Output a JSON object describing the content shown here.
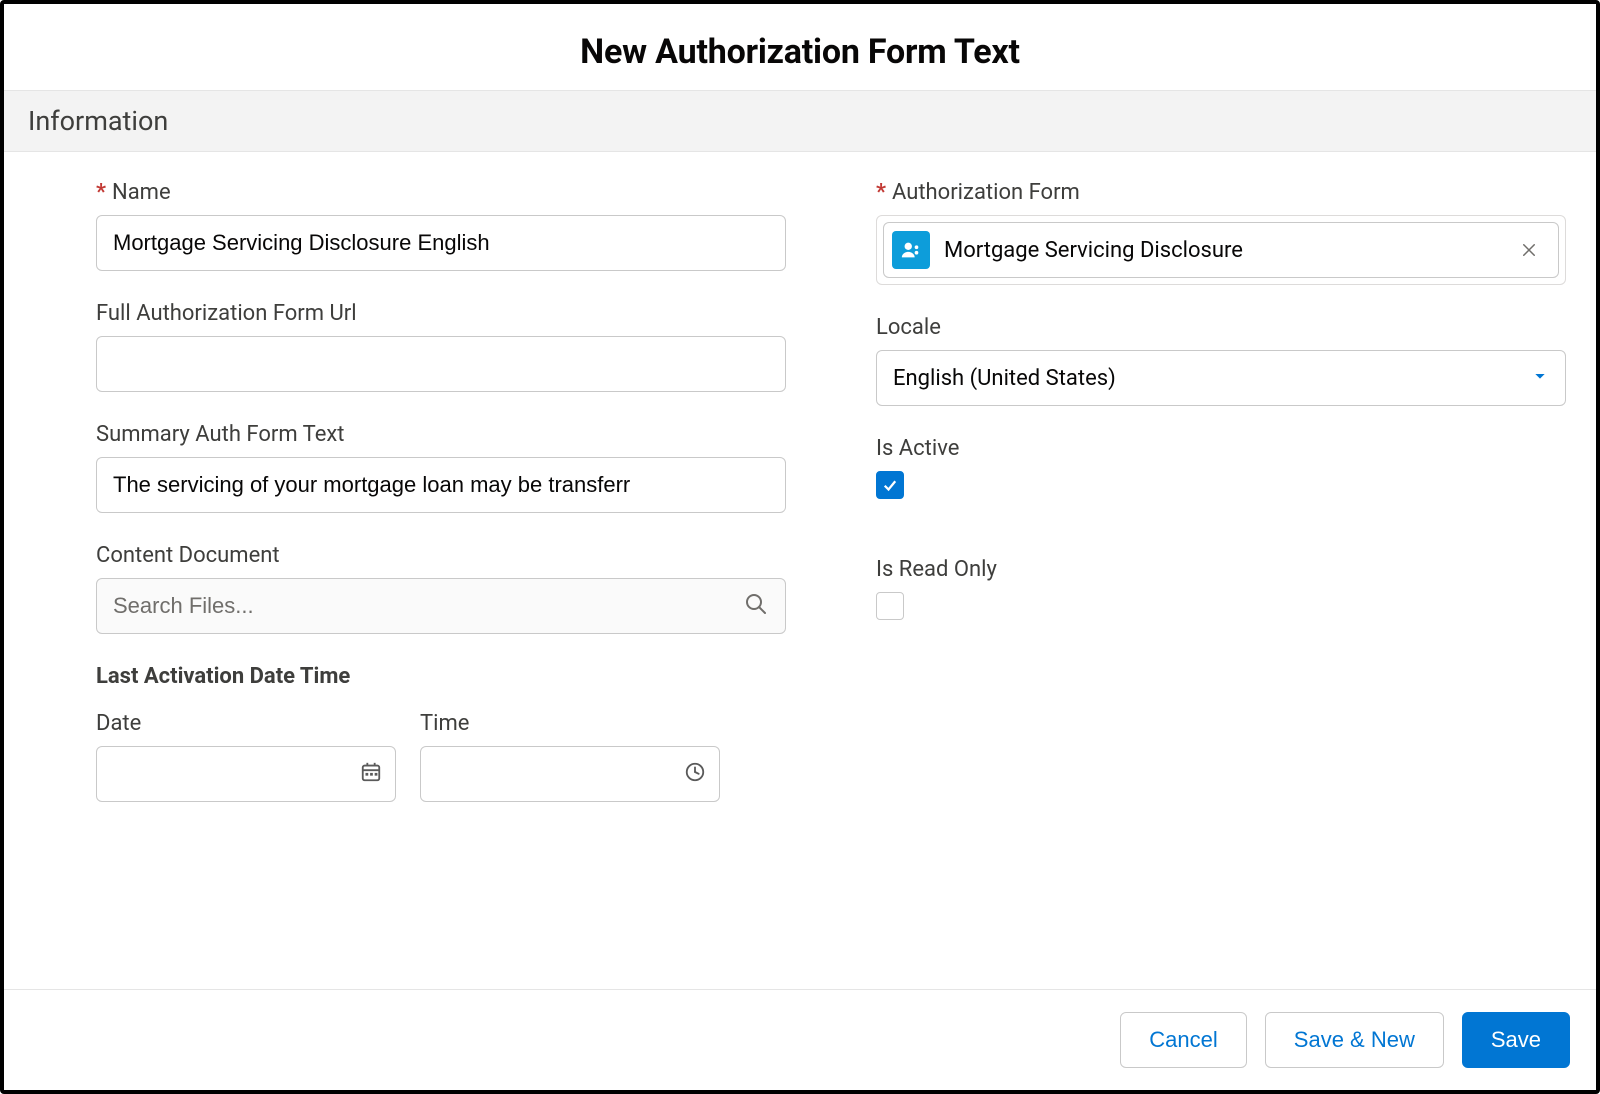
{
  "header": {
    "title": "New Authorization Form Text"
  },
  "section": {
    "title": "Information"
  },
  "fields": {
    "name": {
      "label": "Name",
      "value": "Mortgage Servicing Disclosure English",
      "required_marker": "*"
    },
    "auth_form": {
      "label": "Authorization Form",
      "value": "Mortgage Servicing Disclosure",
      "required_marker": "*"
    },
    "full_url": {
      "label": "Full Authorization Form Url",
      "value": ""
    },
    "locale": {
      "label": "Locale",
      "value": "English (United States)"
    },
    "summary": {
      "label": "Summary Auth Form Text",
      "value": "The servicing of your mortgage loan may be transferr"
    },
    "is_active": {
      "label": "Is Active"
    },
    "content_document": {
      "label": "Content Document",
      "placeholder": "Search Files..."
    },
    "is_read_only": {
      "label": "Is Read Only"
    },
    "last_activation": {
      "heading": "Last Activation Date Time",
      "date_label": "Date",
      "time_label": "Time",
      "date_value": "",
      "time_value": ""
    }
  },
  "footer": {
    "cancel": "Cancel",
    "save_new": "Save & New",
    "save": "Save"
  }
}
